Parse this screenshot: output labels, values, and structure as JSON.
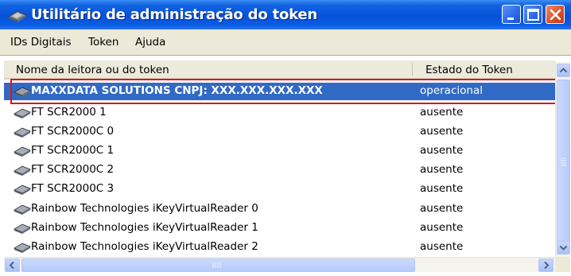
{
  "window": {
    "title": "Utilitário de administração do token",
    "controls": {
      "minimize": "minimize-icon",
      "maximize": "maximize-icon",
      "close": "close-icon"
    }
  },
  "menu": {
    "items": [
      "IDs Digitais",
      "Token",
      "Ajuda"
    ]
  },
  "list": {
    "columns": [
      "Nome da leitora ou do token",
      "Estado do Token"
    ],
    "rows": [
      {
        "name": "MAXXDATA SOLUTIONS CNPJ: XXX.XXX.XXX.XXX",
        "state": "operacional",
        "selected": true
      },
      {
        "name": "FT SCR2000 1",
        "state": "ausente"
      },
      {
        "name": "FT SCR2000C 0",
        "state": "ausente"
      },
      {
        "name": "FT SCR2000C 1",
        "state": "ausente"
      },
      {
        "name": "FT SCR2000C 2",
        "state": "ausente"
      },
      {
        "name": "FT SCR2000C 3",
        "state": "ausente"
      },
      {
        "name": "Rainbow Technologies iKeyVirtualReader 0",
        "state": "ausente"
      },
      {
        "name": "Rainbow Technologies iKeyVirtualReader 1",
        "state": "ausente"
      },
      {
        "name": "Rainbow Technologies iKeyVirtualReader 2",
        "state": "ausente"
      }
    ]
  },
  "colors": {
    "titlebar": "#0652d8",
    "selection": "#316ac5",
    "highlight": "#e01414",
    "menubar": "#ece9d8"
  },
  "icons": [
    "token-icon",
    "reader-icon",
    "scroll-up-icon",
    "scroll-down-icon",
    "scroll-left-icon",
    "scroll-right-icon"
  ]
}
